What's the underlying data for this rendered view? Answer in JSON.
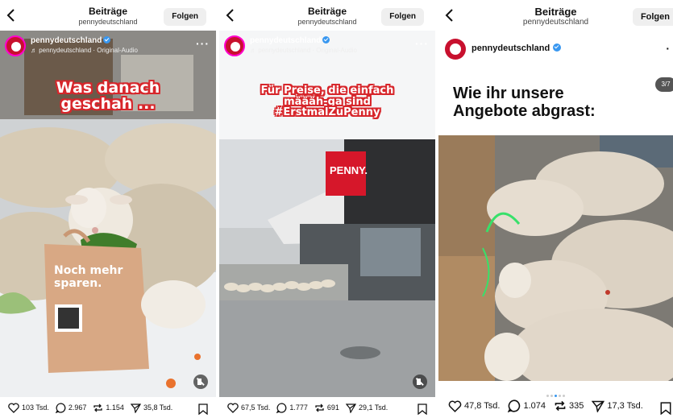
{
  "posts": [
    {
      "header": {
        "title": "Beiträge",
        "subtitle": "pennydeutschland",
        "follow_label": "Folgen"
      },
      "account": {
        "name": "pennydeutschland",
        "audio": "♬ pennydeutschland · Original-Audio"
      },
      "overlay": [
        "Was danach",
        "geschah ..."
      ],
      "bag_text": [
        "Noch mehr",
        "sparen."
      ],
      "stats": {
        "likes": "103 Tsd.",
        "comments": "2.967",
        "reposts": "1.154",
        "shares": "35,8 Tsd."
      }
    },
    {
      "header": {
        "title": "Beiträge",
        "subtitle": "pennydeutschland",
        "follow_label": "Folgen"
      },
      "account": {
        "name": "pennydeutschland",
        "audio": "♬ pennydeutschland · Original-Audio"
      },
      "overlay": [
        "Für Preise, die einfach",
        "määäh-ga sind",
        "#ErstmalZuPenny"
      ],
      "store_sign": "PENNY.",
      "stats": {
        "likes": "67,5 Tsd.",
        "comments": "1.777",
        "reposts": "691",
        "shares": "29,1 Tsd."
      }
    },
    {
      "header": {
        "title": "Beiträge",
        "subtitle": "pennydeutschland",
        "follow_label": "Folgen"
      },
      "account": {
        "name": "pennydeutschland"
      },
      "headline": [
        "Wie ihr unsere",
        "Angebote abgrast:"
      ],
      "counter": "3/7",
      "stats": {
        "likes": "47,8 Tsd.",
        "comments": "1.074",
        "reposts": "335",
        "shares": "17,3 Tsd."
      }
    }
  ],
  "colors": {
    "brand_red": "#c8102e",
    "verified": "#3897f0",
    "overlay_outline": "#d7262b"
  },
  "icons": [
    "back-arrow-icon",
    "verified-icon",
    "more-icon",
    "heart-icon",
    "comment-icon",
    "repost-icon",
    "share-icon",
    "bookmark-icon",
    "mute-icon"
  ]
}
